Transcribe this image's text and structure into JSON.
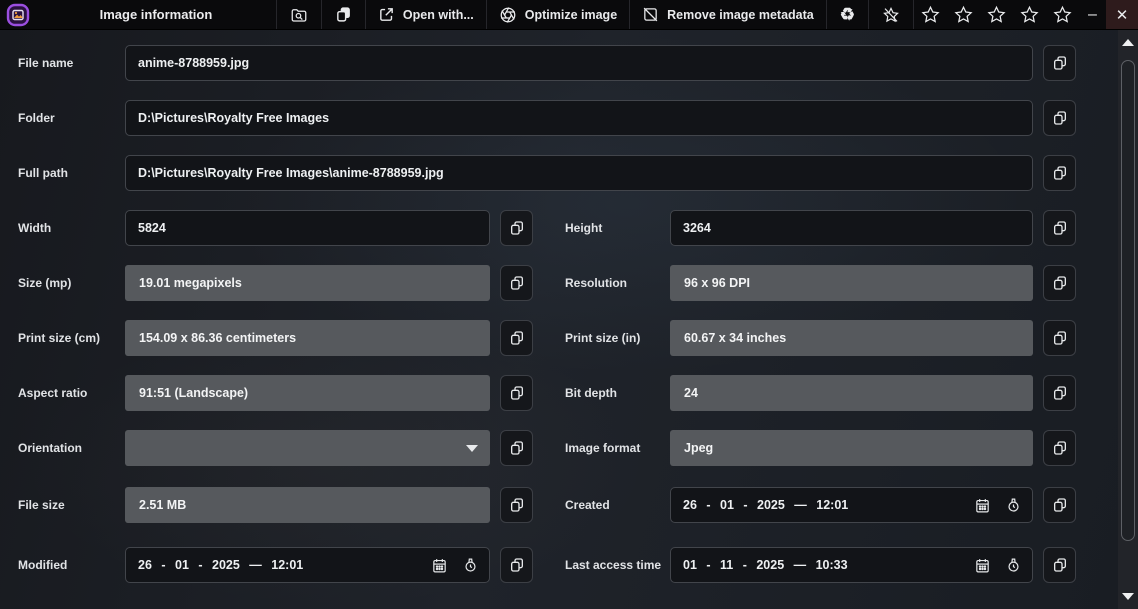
{
  "window": {
    "title": "Image information",
    "minimize_glyph": "–",
    "close_glyph": "✕"
  },
  "titlebar": {
    "open_with_label": "Open with...",
    "optimize_label": "Optimize image",
    "remove_metadata_label": "Remove image metadata",
    "recycle_glyph": "♻",
    "rating_star_count": 5
  },
  "colors": {
    "titlebar_bg": "#0a0a0c",
    "close_button_bg": "#2e1b1c",
    "logo_purple": "#9b4fe0",
    "editable_field_bg": "#121418",
    "readonly_field_bg": "#56595d",
    "content_bg": "#1f232a"
  },
  "fields": {
    "file_name": {
      "label": "File name",
      "value": "anime-8788959.jpg"
    },
    "folder": {
      "label": "Folder",
      "value": "D:\\Pictures\\Royalty Free Images"
    },
    "full_path": {
      "label": "Full path",
      "value": "D:\\Pictures\\Royalty Free Images\\anime-8788959.jpg"
    },
    "width": {
      "label": "Width",
      "value": "5824"
    },
    "height": {
      "label": "Height",
      "value": "3264"
    },
    "size_mp": {
      "label": "Size (mp)",
      "value": "19.01 megapixels"
    },
    "resolution": {
      "label": "Resolution",
      "value": "96 x 96 DPI"
    },
    "print_size_cm": {
      "label": "Print size (cm)",
      "value": "154.09 x 86.36 centimeters"
    },
    "print_size_in": {
      "label": "Print size (in)",
      "value": "60.67 x 34 inches"
    },
    "aspect_ratio": {
      "label": "Aspect ratio",
      "value": "91:51 (Landscape)"
    },
    "bit_depth": {
      "label": "Bit depth",
      "value": "24"
    },
    "orientation": {
      "label": "Orientation",
      "value": ""
    },
    "image_format": {
      "label": "Image format",
      "value": "Jpeg"
    },
    "file_size": {
      "label": "File size",
      "value": "2.51 MB"
    },
    "created": {
      "label": "Created",
      "value": "26 - 01 - 2025 — 12:01"
    },
    "modified": {
      "label": "Modified",
      "value": "26 - 01 - 2025 — 12:01"
    },
    "last_access": {
      "label": "Last access time",
      "value": "01 - 11 - 2025 — 10:33"
    }
  }
}
